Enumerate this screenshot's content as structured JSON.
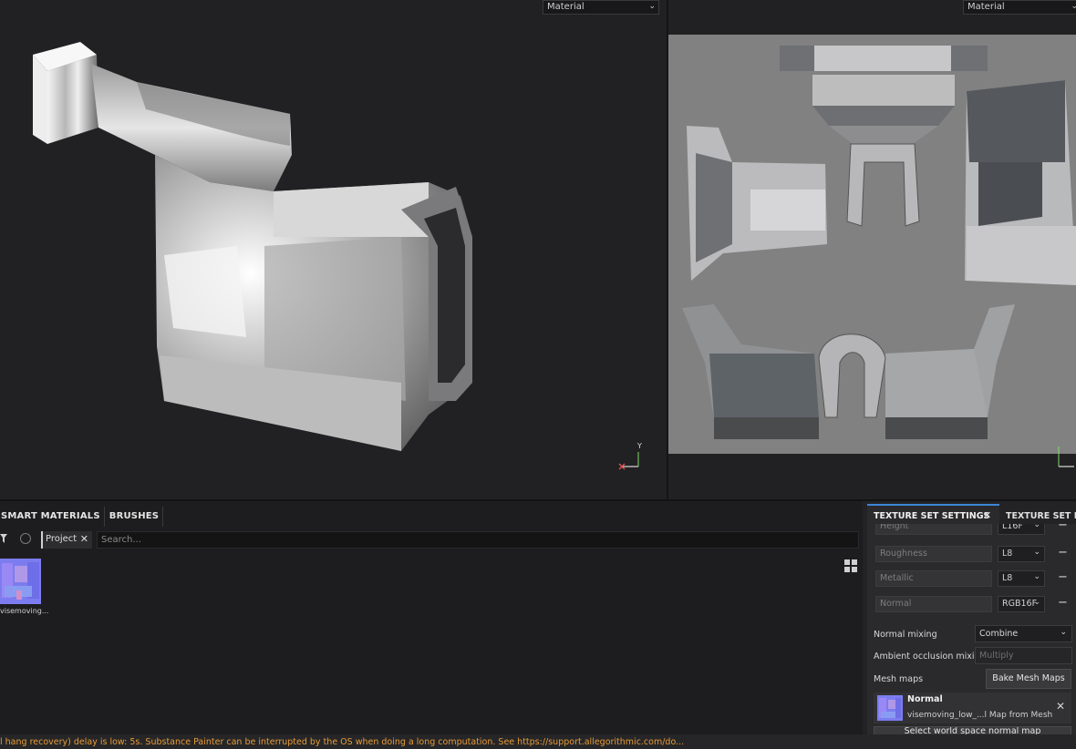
{
  "viewport3d": {
    "mode_label": "Material"
  },
  "viewport2d": {
    "mode_label": "Material"
  },
  "axis": {
    "y_label": "Y"
  },
  "shelf": {
    "tabs": [
      "SMART MATERIALS",
      "BRUSHES"
    ],
    "filter_chip": "Project",
    "search_placeholder": "Search...",
    "items": [
      {
        "label": "visemoving..."
      }
    ]
  },
  "texture_set_settings": {
    "tab_active": "TEXTURE SET SETTINGS",
    "tab_other": "TEXTURE SET LIS",
    "channels": [
      {
        "name": "Height",
        "format": "L16F"
      },
      {
        "name": "Roughness",
        "format": "L8"
      },
      {
        "name": "Metallic",
        "format": "L8"
      },
      {
        "name": "Normal",
        "format": "RGB16F"
      }
    ],
    "normal_mixing_label": "Normal mixing",
    "normal_mixing_value": "Combine",
    "ao_mixing_label": "Ambient occlusion mixing",
    "ao_mixing_value": "Multiply",
    "mesh_maps_label": "Mesh maps",
    "bake_button": "Bake Mesh Maps",
    "mesh_map": {
      "title": "Normal",
      "subtitle": "visemoving_low_...l Map from Mesh"
    },
    "select_button": "Select world space normal map"
  },
  "status": {
    "message": "l hang recovery) delay is low: 5s. Substance Painter can be interrupted by the OS when doing a long computation. See https://support.allegorithmic.com/do..."
  },
  "colors": {
    "accent": "#3d86d6",
    "warning": "#e89b36"
  }
}
